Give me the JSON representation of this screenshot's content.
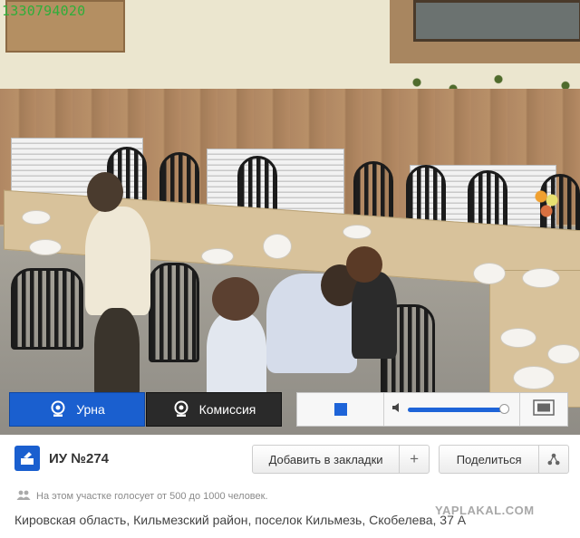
{
  "stream": {
    "overlay_text": "1330794020"
  },
  "player": {
    "tabs": [
      {
        "label": "Урна",
        "icon": "webcam-icon",
        "active": true
      },
      {
        "label": "Комиссия",
        "icon": "webcam-icon",
        "active": false
      }
    ],
    "volume_level": 0.95,
    "controls": {
      "stop_icon": "stop-icon",
      "volume_icon": "speaker-icon",
      "fullscreen_icon": "fullscreen-icon"
    }
  },
  "station": {
    "name": "ИУ №274",
    "bookmark_label": "Добавить в закладки",
    "share_label": "Поделиться",
    "voters_text": "На этом участке голосует от 500 до 1000 человек.",
    "address": "Кировская область, Кильмезский район, поселок Кильмезь, Скобелева, 37 А"
  },
  "watermark": "YAPLAKAL.COM",
  "colors": {
    "accent": "#1a5fcf",
    "dark_tab": "#2a2a2a",
    "overlay_green": "#2fae3a"
  }
}
